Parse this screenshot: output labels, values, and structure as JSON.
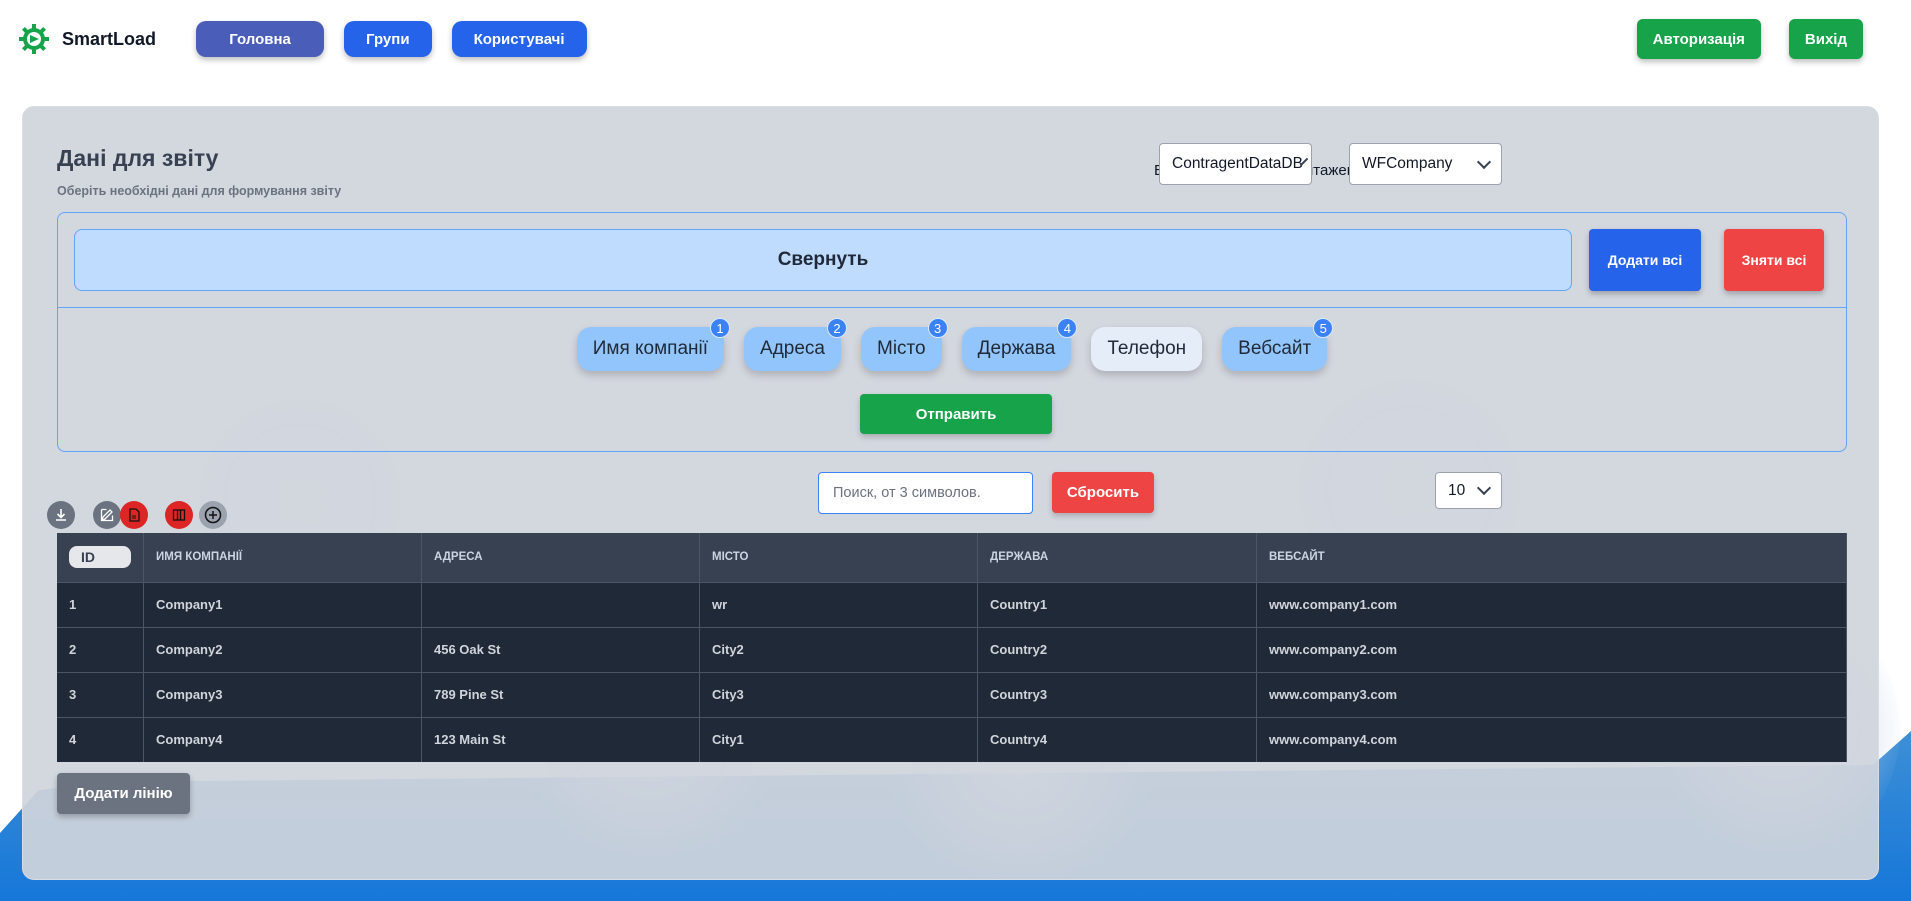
{
  "app": {
    "name": "SmartLoad",
    "logo_icon": "gear-icon"
  },
  "nav": {
    "home": "Головна",
    "groups": "Групи",
    "users": "Користувачі",
    "login": "Авторизація",
    "logout": "Вихід"
  },
  "report": {
    "title": "Дані для звіту",
    "subtitle": "Оберіть необхідні дані для формування звіту",
    "db_label": "Виберіть БД для завантаження:",
    "db_select": "ContragentDataDB",
    "table_select": "WFCompany"
  },
  "selector": {
    "collapse": "Свернуть",
    "add_all": "Додати всі",
    "remove_all": "Зняти всі",
    "fields": [
      {
        "label": "Имя компанії",
        "badge": "1",
        "selected": true
      },
      {
        "label": "Адреса",
        "badge": "2",
        "selected": true
      },
      {
        "label": "Місто",
        "badge": "3",
        "selected": true
      },
      {
        "label": "Держава",
        "badge": "4",
        "selected": true
      },
      {
        "label": "Телефон",
        "badge": "",
        "selected": false
      },
      {
        "label": "Вебсайт",
        "badge": "5",
        "selected": true
      }
    ],
    "send": "Отправить"
  },
  "toolbar": {
    "icons": [
      "download-icon",
      "edit-icon",
      "pdf-icon",
      "columns-icon",
      "add-circle-icon"
    ],
    "search_placeholder": "Поиск, от 3 символов.",
    "reset": "Сбросить",
    "page_size": "10"
  },
  "table": {
    "headers": [
      "ID",
      "ИМЯ КОМПАНІЇ",
      "АДРЕСА",
      "МІСТО",
      "ДЕРЖАВА",
      "ВЕБСАЙТ"
    ],
    "rows": [
      [
        "1",
        "Company1",
        "",
        "wr",
        "Country1",
        "www.company1.com"
      ],
      [
        "2",
        "Company2",
        "456 Oak St",
        "City2",
        "Country2",
        "www.company2.com"
      ],
      [
        "3",
        "Company3",
        "789 Pine St",
        "City3",
        "Country3",
        "www.company3.com"
      ],
      [
        "4",
        "Company4",
        "123 Main St",
        "City1",
        "Country4",
        "www.company4.com"
      ]
    ]
  },
  "add_line": "Додати лінію",
  "colors": {
    "primary": "#2563eb",
    "success": "#16a34a",
    "danger": "#ef4444",
    "table_bg": "#1f2937"
  }
}
